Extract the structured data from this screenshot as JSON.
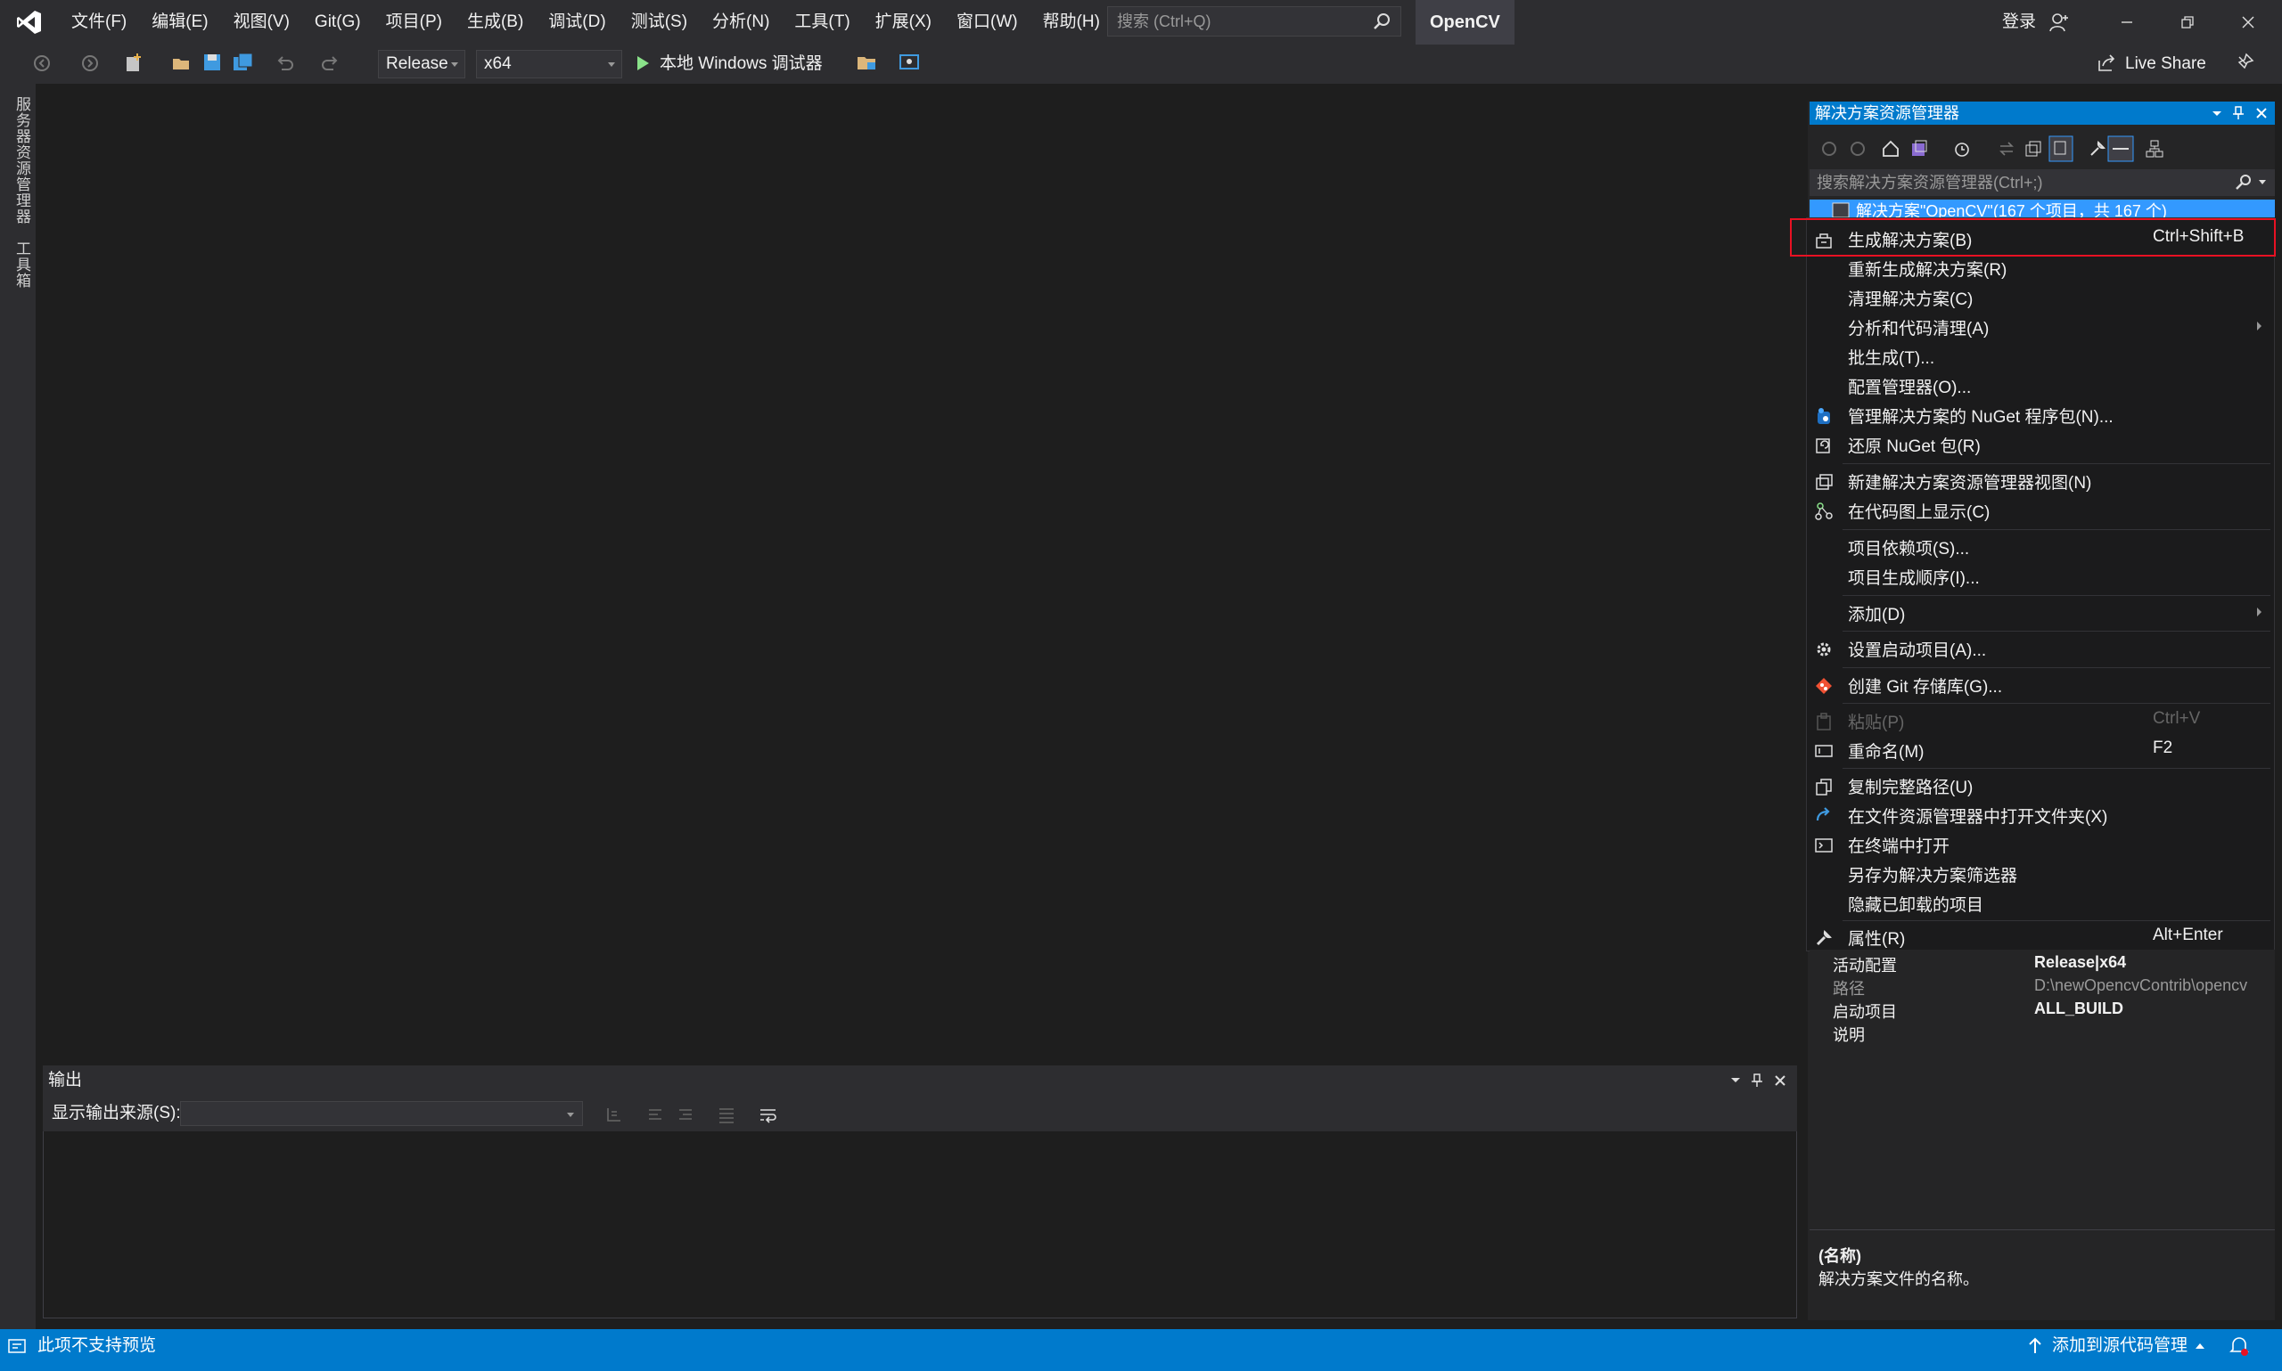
{
  "menu": {
    "items": [
      "文件(F)",
      "编辑(E)",
      "视图(V)",
      "Git(G)",
      "项目(P)",
      "生成(B)",
      "调试(D)",
      "测试(S)",
      "分析(N)",
      "工具(T)",
      "扩展(X)",
      "窗口(W)",
      "帮助(H)"
    ],
    "search_placeholder": "搜索 (Ctrl+Q)",
    "solution_name": "OpenCV",
    "login": "登录"
  },
  "toolbar": {
    "config": "Release",
    "platform": "x64",
    "run_label": "本地 Windows 调试器",
    "live_share": "Live Share"
  },
  "left_strip": {
    "tabs": [
      "服务器资源管理器",
      "工具箱"
    ]
  },
  "solution_explorer": {
    "title": "解决方案资源管理器",
    "search_placeholder": "搜索解决方案资源管理器(Ctrl+;)",
    "root_label": "解决方案\"OpenCV\"(167 个项目，共 167 个)"
  },
  "context_menu": {
    "items": [
      {
        "label": "生成解决方案(B)",
        "shortcut": "Ctrl+Shift+B",
        "icon": "build-solution-icon"
      },
      {
        "label": "重新生成解决方案(R)",
        "shortcut": "",
        "icon": ""
      },
      {
        "label": "清理解决方案(C)",
        "shortcut": "",
        "icon": ""
      },
      {
        "label": "分析和代码清理(A)",
        "shortcut": "",
        "icon": ""
      },
      {
        "label": "批生成(T)...",
        "shortcut": "",
        "icon": ""
      },
      {
        "label": "配置管理器(O)...",
        "shortcut": "",
        "icon": ""
      },
      {
        "label": "管理解决方案的 NuGet 程序包(N)...",
        "shortcut": "",
        "icon": "nuget-icon"
      },
      {
        "label": "还原 NuGet 包(R)",
        "shortcut": "",
        "icon": "restore-icon"
      },
      {
        "label": "新建解决方案资源管理器视图(N)",
        "shortcut": "",
        "icon": "new-view-icon"
      },
      {
        "label": "在代码图上显示(C)",
        "shortcut": "",
        "icon": "code-map-icon"
      },
      {
        "label": "项目依赖项(S)...",
        "shortcut": "",
        "icon": ""
      },
      {
        "label": "项目生成顺序(I)...",
        "shortcut": "",
        "icon": ""
      },
      {
        "label": "添加(D)",
        "shortcut": "",
        "icon": ""
      },
      {
        "label": "设置启动项目(A)...",
        "shortcut": "",
        "icon": "gear-icon"
      },
      {
        "label": "创建 Git 存储库(G)...",
        "shortcut": "",
        "icon": "git-icon"
      },
      {
        "label": "粘贴(P)",
        "shortcut": "Ctrl+V",
        "icon": "paste-icon"
      },
      {
        "label": "重命名(M)",
        "shortcut": "F2",
        "icon": "rename-icon"
      },
      {
        "label": "复制完整路径(U)",
        "shortcut": "",
        "icon": "copy-icon"
      },
      {
        "label": "在文件资源管理器中打开文件夹(X)",
        "shortcut": "",
        "icon": "open-folder-icon"
      },
      {
        "label": "在终端中打开",
        "shortcut": "",
        "icon": "terminal-icon"
      },
      {
        "label": "另存为解决方案筛选器",
        "shortcut": "",
        "icon": ""
      },
      {
        "label": "隐藏已卸载的项目",
        "shortcut": "",
        "icon": ""
      },
      {
        "label": "属性(R)",
        "shortcut": "Alt+Enter",
        "icon": "wrench-icon"
      }
    ]
  },
  "properties": {
    "rows": [
      {
        "name": "活动配置",
        "value": "Release|x64"
      },
      {
        "name": "路径",
        "value": "D:\\newOpencvContrib\\opencv"
      },
      {
        "name": "启动项目",
        "value": "ALL_BUILD"
      },
      {
        "name": "说明",
        "value": ""
      }
    ],
    "desc_title": "(名称)",
    "desc_text": "解决方案文件的名称。"
  },
  "output": {
    "title": "输出",
    "source_label": "显示输出来源(S):"
  },
  "status": {
    "text": "此项不支持预览",
    "source_control": "添加到源代码管理"
  },
  "colors": {
    "accent": "#007acc",
    "highlight_border": "#e81123",
    "background": "#1e1e1e",
    "chrome": "#2d2d30"
  }
}
